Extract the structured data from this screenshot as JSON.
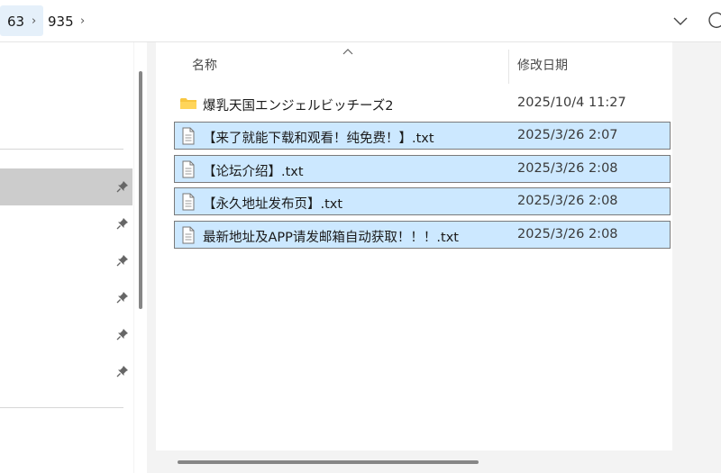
{
  "address_bar": {
    "crumbs": [
      "63",
      "935"
    ],
    "separator": "›"
  },
  "file_list": {
    "columns": {
      "name": "名称",
      "modified": "修改日期"
    },
    "sort_indicator": "ascending",
    "rows": [
      {
        "type": "folder",
        "name": "爆乳天国エンジェルビッチーズ2",
        "modified": "2025/10/4 11:27",
        "selected": false
      },
      {
        "type": "txt",
        "name": "【来了就能下载和观看！纯免费！】.txt",
        "modified": "2025/3/26 2:07",
        "selected": true
      },
      {
        "type": "txt",
        "name": "【论坛介绍】.txt",
        "modified": "2025/3/26 2:08",
        "selected": true
      },
      {
        "type": "txt",
        "name": "【永久地址发布页】.txt",
        "modified": "2025/3/26 2:08",
        "selected": true
      },
      {
        "type": "txt",
        "name": "最新地址及APP请发邮箱自动获取！！！.txt",
        "modified": "2025/3/26 2:08",
        "selected": true
      }
    ]
  },
  "colors": {
    "selection_fill": "#cce8ff",
    "selection_border": "#7a7a7a",
    "folder_yellow": "#f8c640",
    "nav_selected": "#cccccc"
  },
  "icons": {
    "nav_pin": "pin-icon",
    "address_dropdown": "chevron-down-icon",
    "address_refresh": "refresh-icon",
    "folder": "folder-icon",
    "text_file": "text-file-icon"
  }
}
